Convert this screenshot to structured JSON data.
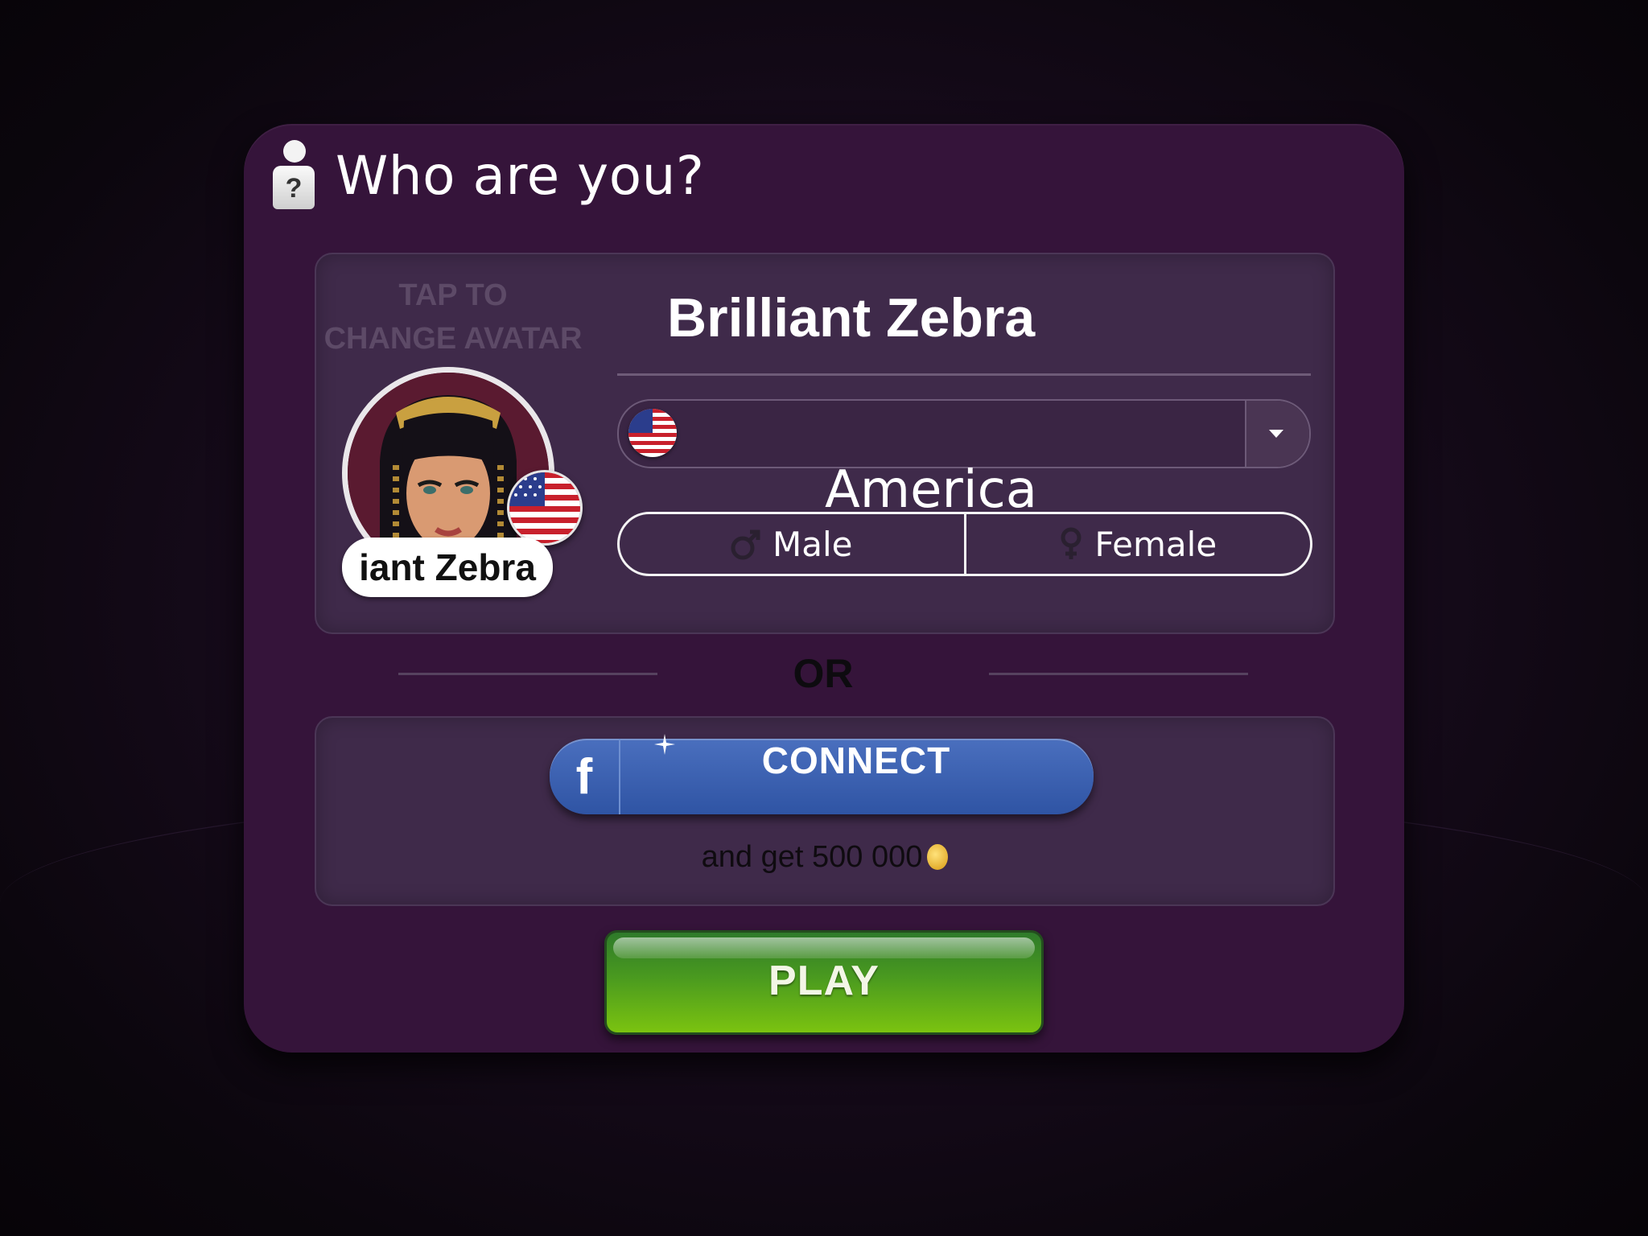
{
  "dialog": {
    "title": "Who are you?",
    "title_icon": "user-question-icon"
  },
  "profile": {
    "tap_hint_line1": "TAP TO",
    "tap_hint_line2": "CHANGE AVATAR",
    "avatar_name_badge": "iant Zebra",
    "player_name": "Brilliant Zebra",
    "country": "America",
    "country_flag_icon": "us-flag-icon",
    "gender_options": [
      {
        "label": "Male",
        "icon": "male-symbol-icon"
      },
      {
        "label": "Female",
        "icon": "female-symbol-icon"
      }
    ]
  },
  "separator": {
    "label": "OR"
  },
  "facebook": {
    "button_label": "CONNECT",
    "icon": "facebook-icon",
    "reward_text": "and get 500 000",
    "reward_icon": "coin-icon",
    "brand_color": "#3b5ba9"
  },
  "play": {
    "label": "PLAY",
    "color": "#5aa51a"
  }
}
